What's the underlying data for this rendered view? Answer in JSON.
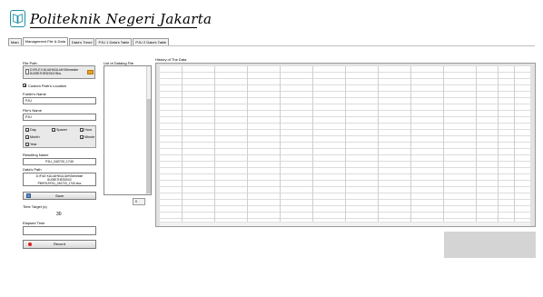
{
  "header": {
    "title": "Politeknik Negeri Jakarta"
  },
  "tabs": [
    {
      "label": "Main",
      "active": false
    },
    {
      "label": "Management File & Data",
      "active": true
    },
    {
      "label": "Data's Trend",
      "active": false
    },
    {
      "label": "PJU 1 Data's Table",
      "active": false
    },
    {
      "label": "PJU 2 Data's Table",
      "active": false
    }
  ],
  "file_path": {
    "label": "File Path",
    "value": "D:\\FILE KULIAH\\KULIAH\\Semester 8\\JOB\\THESIS\\02 Bhs"
  },
  "custom_path": {
    "label": "Custom Path's Location",
    "checked": true
  },
  "folder_name": {
    "label": "Folder's Name",
    "value": "PJU"
  },
  "file_name": {
    "label": "File's Name",
    "value": "PJU"
  },
  "time_options": {
    "day": {
      "label": "Day",
      "checked": true
    },
    "spacer": {
      "label": "Spacer",
      "checked": true
    },
    "hour": {
      "label": "Hour",
      "checked": true
    },
    "month": {
      "label": "Month",
      "checked": true
    },
    "minute": {
      "label": "Minute",
      "checked": true
    },
    "year": {
      "label": "Year",
      "checked": true
    }
  },
  "resulting_name": {
    "label": "Resulting Name",
    "value": "PJU_240720_1740"
  },
  "data_path": {
    "label": "Data's Path",
    "value": "D:\\FILE KULIAH\\KULIAH\\Semester 8\\JOB\\THESIS\\02 PM\\PJU\\PJU_240720_1740.xlsx"
  },
  "save_button": {
    "label": "Save"
  },
  "time_target": {
    "label": "Time Target (s)",
    "value": "30"
  },
  "elapsed_time": {
    "label": "Elapsed Time",
    "value": ""
  },
  "record_button": {
    "label": "Record"
  },
  "data_list": {
    "label": "List of Datalog File",
    "index_value": "0"
  },
  "history": {
    "label": "History of The Data"
  },
  "colors": {
    "accent": "#1d8fa5",
    "record": "#e02020",
    "folder": "#e6a126"
  }
}
